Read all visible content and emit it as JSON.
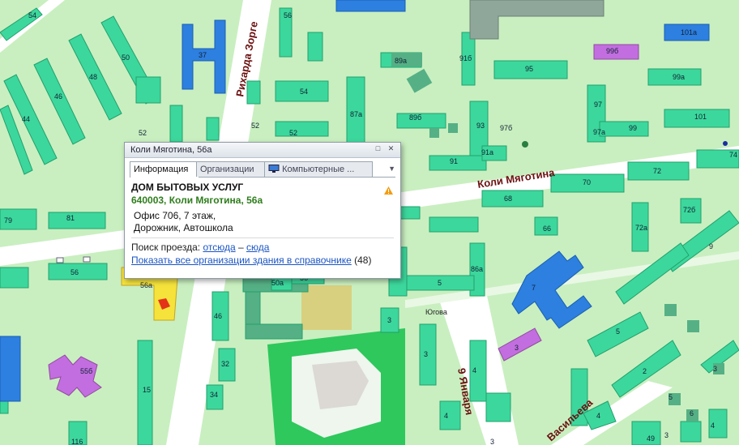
{
  "streets": {
    "koli_myagotina": "Коли Мяготина",
    "richarda_zorge": "Рихарда Зорге",
    "yanvarya_9": "9 Января",
    "vasilyeva": "Васильева",
    "yugova": "Югова"
  },
  "buildings": [
    "54",
    "50",
    "48",
    "46",
    "44",
    "37",
    "52",
    "56",
    "79",
    "81",
    "54",
    "52",
    "52а",
    "6",
    "7",
    "89а",
    "91б",
    "95",
    "99а",
    "101а",
    "99б",
    "89б",
    "97б",
    "97",
    "87а",
    "93",
    "97а",
    "99",
    "101",
    "91",
    "91а",
    "74",
    "72",
    "70",
    "68",
    "72б",
    "72а",
    "66",
    "9",
    "86а",
    "5",
    "3",
    "46",
    "32",
    "34",
    "15",
    "7",
    "56а",
    "50а",
    "5б",
    "3",
    "2",
    "4",
    "3",
    "4",
    "116",
    "49",
    "60"
  ],
  "popup": {
    "title": "Коли Мяготина, 56а",
    "tabs": {
      "info": "Информация",
      "orgs": "Организации",
      "computer": "Компьютерные ..."
    },
    "org_name": "ДОМ БЫТОВЫХ УСЛУГ",
    "address": "640003, Коли Мяготина, 56а",
    "office_line1": "Офис 706, 7 этаж,",
    "office_line2": "Дорожник, Автошкола",
    "route_label": "Поиск проезда:",
    "route_from": "отсюда",
    "route_sep": "–",
    "route_to": "сюда",
    "all_orgs_link": "Показать все организации здания в справочнике",
    "all_orgs_count": "(48)"
  },
  "colors": {
    "map_bg": "#c9efc0",
    "building": "#3cd79c",
    "building_stroke": "#22a06d",
    "road": "#ffffff",
    "edu_building": "#2d7fe0",
    "purple_building": "#c26ee0",
    "selected_building": "#f5e33b",
    "park": "#2ec85c"
  }
}
